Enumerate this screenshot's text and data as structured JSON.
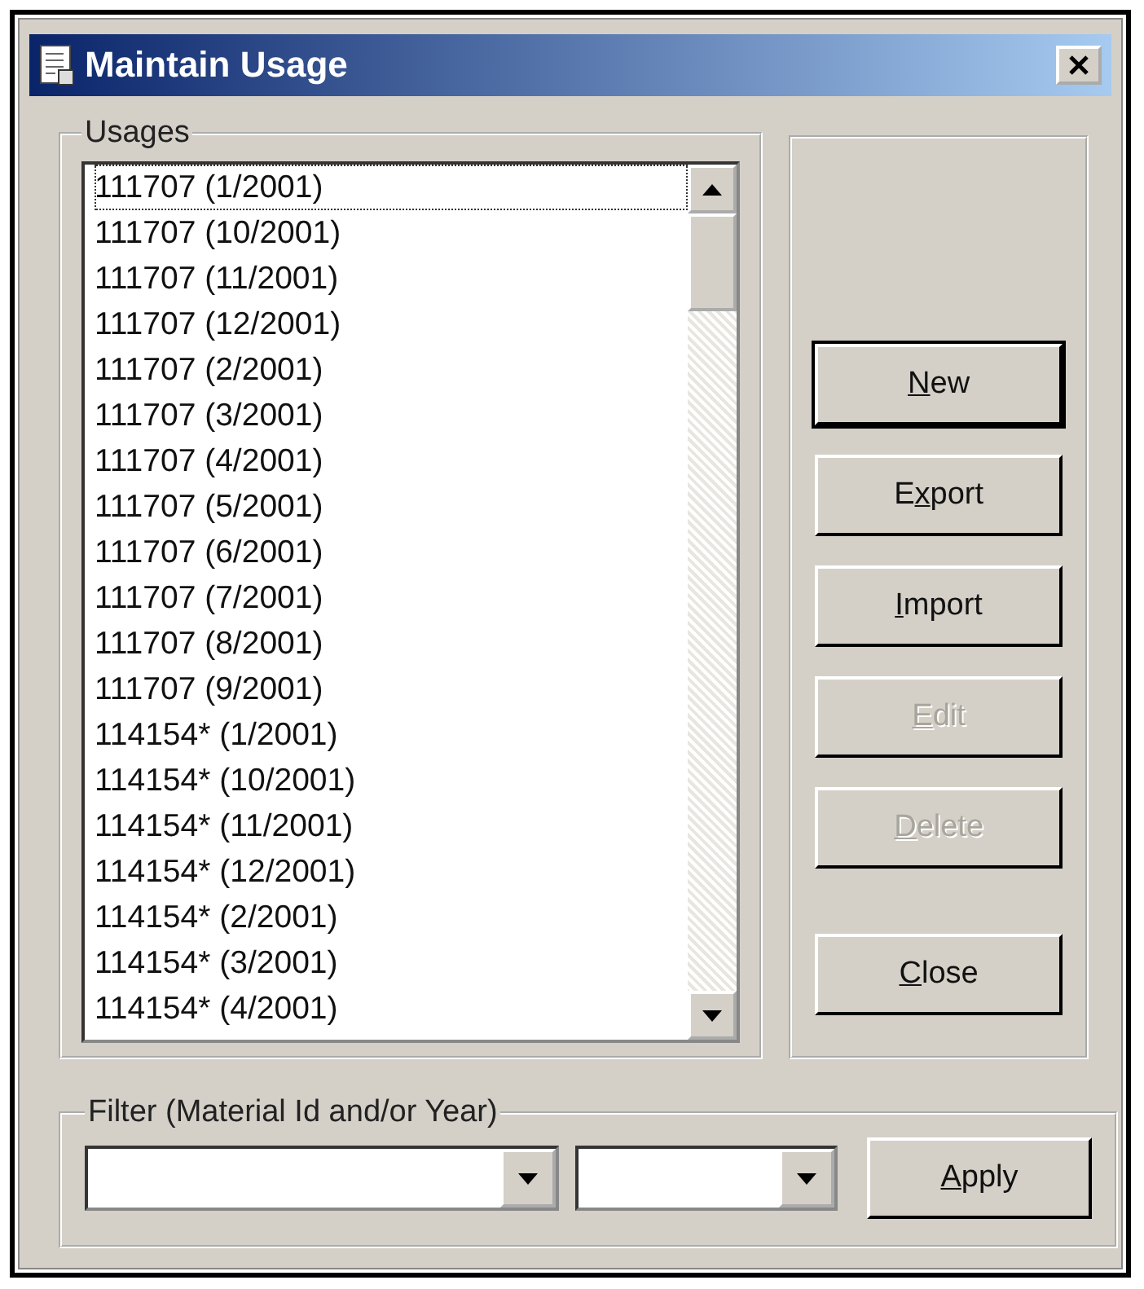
{
  "window": {
    "title": "Maintain Usage"
  },
  "usages": {
    "label": "Usages",
    "items": [
      {
        "text": "111707 (1/2001)",
        "selected": true
      },
      {
        "text": "111707 (10/2001)",
        "selected": false
      },
      {
        "text": "111707 (11/2001)",
        "selected": false
      },
      {
        "text": "111707 (12/2001)",
        "selected": false
      },
      {
        "text": "111707 (2/2001)",
        "selected": false
      },
      {
        "text": "111707 (3/2001)",
        "selected": false
      },
      {
        "text": "111707 (4/2001)",
        "selected": false
      },
      {
        "text": "111707 (5/2001)",
        "selected": false
      },
      {
        "text": "111707 (6/2001)",
        "selected": false
      },
      {
        "text": "111707 (7/2001)",
        "selected": false
      },
      {
        "text": "111707 (8/2001)",
        "selected": false
      },
      {
        "text": "111707 (9/2001)",
        "selected": false
      },
      {
        "text": "114154* (1/2001)",
        "selected": false
      },
      {
        "text": "114154* (10/2001)",
        "selected": false
      },
      {
        "text": "114154* (11/2001)",
        "selected": false
      },
      {
        "text": "114154* (12/2001)",
        "selected": false
      },
      {
        "text": "114154* (2/2001)",
        "selected": false
      },
      {
        "text": "114154* (3/2001)",
        "selected": false
      },
      {
        "text": "114154* (4/2001)",
        "selected": false
      }
    ]
  },
  "buttons": [
    {
      "access_key": "N",
      "after": "ew",
      "disabled": false,
      "default": true
    },
    {
      "before": "E",
      "access_key": "x",
      "after": "port",
      "disabled": false,
      "default": false
    },
    {
      "access_key": "I",
      "after": "mport",
      "disabled": false,
      "default": false
    },
    {
      "access_key": "E",
      "after": "dit",
      "disabled": true,
      "default": false
    },
    {
      "access_key": "D",
      "after": "elete",
      "disabled": true,
      "default": false
    },
    {
      "access_key": "C",
      "after": "lose",
      "disabled": false,
      "default": false
    }
  ],
  "filter": {
    "label": "Filter (Material Id and/or Year)",
    "apply": {
      "access_key": "A",
      "after": "pply"
    }
  }
}
